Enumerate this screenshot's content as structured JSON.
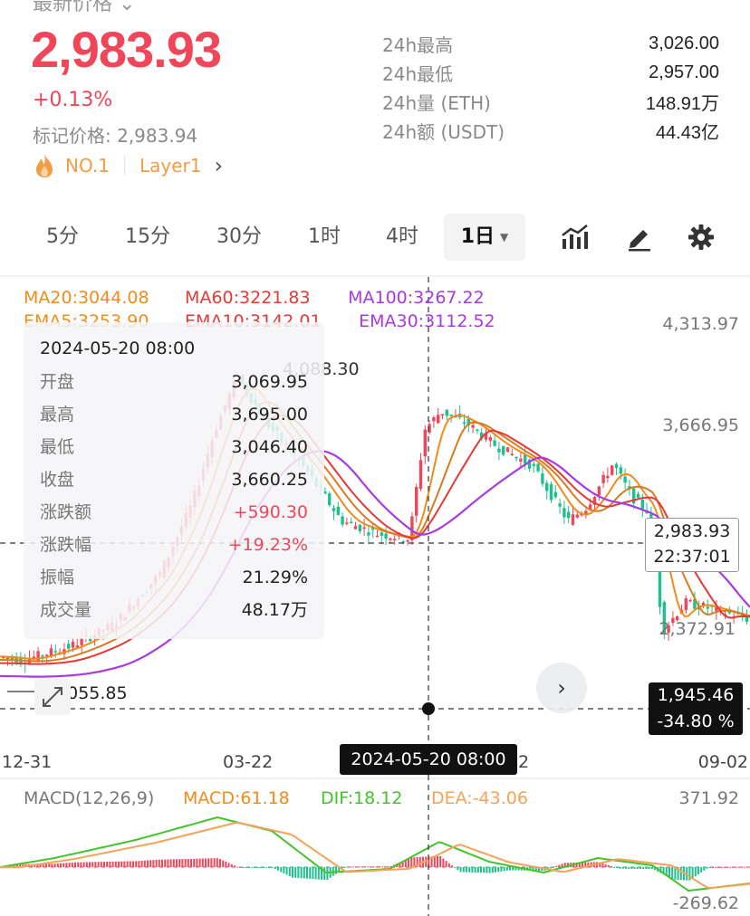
{
  "header": {
    "top_cut_label": "最新价格 ⌄",
    "last_price": "2,983.93",
    "change_pct": "+0.13%",
    "mark_price": "标记价格: 2,983.94",
    "rank": "NO.1",
    "sector": "Layer1",
    "chevron": "›",
    "stats": [
      {
        "label": "24h最高",
        "value": "3,026.00"
      },
      {
        "label": "24h最低",
        "value": "2,957.00"
      },
      {
        "label": "24h量 (ETH)",
        "value": "148.91万"
      },
      {
        "label": "24h额 (USDT)",
        "value": "44.43亿"
      }
    ]
  },
  "tabs": {
    "items": [
      "5分",
      "15分",
      "30分",
      "1时",
      "4时"
    ],
    "active": "1日",
    "active_caret": "▼"
  },
  "icons": {
    "indicator": "indicator-icon",
    "draw": "draw-pencil-icon",
    "settings": "gear-icon",
    "fire": "fire-icon",
    "expand": "expand-icon",
    "next": "chevron-right-icon"
  },
  "chart": {
    "ma_row1": [
      {
        "text": "MA20:3044.08",
        "color": "#f08c1c"
      },
      {
        "text": "MA60:3221.83",
        "color": "#e53935"
      },
      {
        "text": "MA100:3267.22",
        "color": "#a83be0"
      }
    ],
    "ma_row2": [
      {
        "text": "EMA5:3253.90",
        "color": "#f08c1c"
      },
      {
        "text": "EMA10:3142.01",
        "color": "#e53935"
      },
      {
        "text": "EMA30:3112.52",
        "color": "#a83be0"
      }
    ],
    "y_labels": [
      "4,313.97",
      "3,666.95",
      "2,372.91"
    ],
    "peak_label": "4,088.30",
    "low_label": "2,055.85",
    "x_labels": [
      "12-31",
      "03-22",
      "09-02"
    ],
    "x_label_fragment": "2",
    "current_price_tag": [
      "2,983.93",
      "22:37:01"
    ],
    "low_tag": [
      "1,945.46",
      "-34.80 %"
    ],
    "crosshair_date": "2024-05-20 08:00",
    "nav": "›",
    "colors": {
      "up": "#f0465a",
      "down": "#1fbf8f",
      "ma_orange": "#f08c1c",
      "ma_red": "#e53935",
      "ma_purple": "#a83be0"
    }
  },
  "tooltip": {
    "date": "2024-05-20 08:00",
    "rows": [
      {
        "label": "开盘",
        "value": "3,069.95"
      },
      {
        "label": "最高",
        "value": "3,695.00"
      },
      {
        "label": "最低",
        "value": "3,046.40"
      },
      {
        "label": "收盘",
        "value": "3,660.25"
      },
      {
        "label": "涨跌额",
        "value": "+590.30",
        "up": true
      },
      {
        "label": "涨跌幅",
        "value": "+19.23%",
        "up": true
      },
      {
        "label": "振幅",
        "value": "21.29%"
      },
      {
        "label": "成交量",
        "value": "48.17万"
      }
    ]
  },
  "macd": {
    "labels": [
      {
        "text": "MACD(12,26,9)",
        "color": "#777777"
      },
      {
        "text": "MACD:61.18",
        "color": "#f08c1c"
      },
      {
        "text": "DIF:18.12",
        "color": "#43c42b"
      },
      {
        "text": "DEA:-43.06",
        "color": "#f5a35a"
      }
    ],
    "y_top": "371.92",
    "y_bottom": "-269.62"
  }
}
